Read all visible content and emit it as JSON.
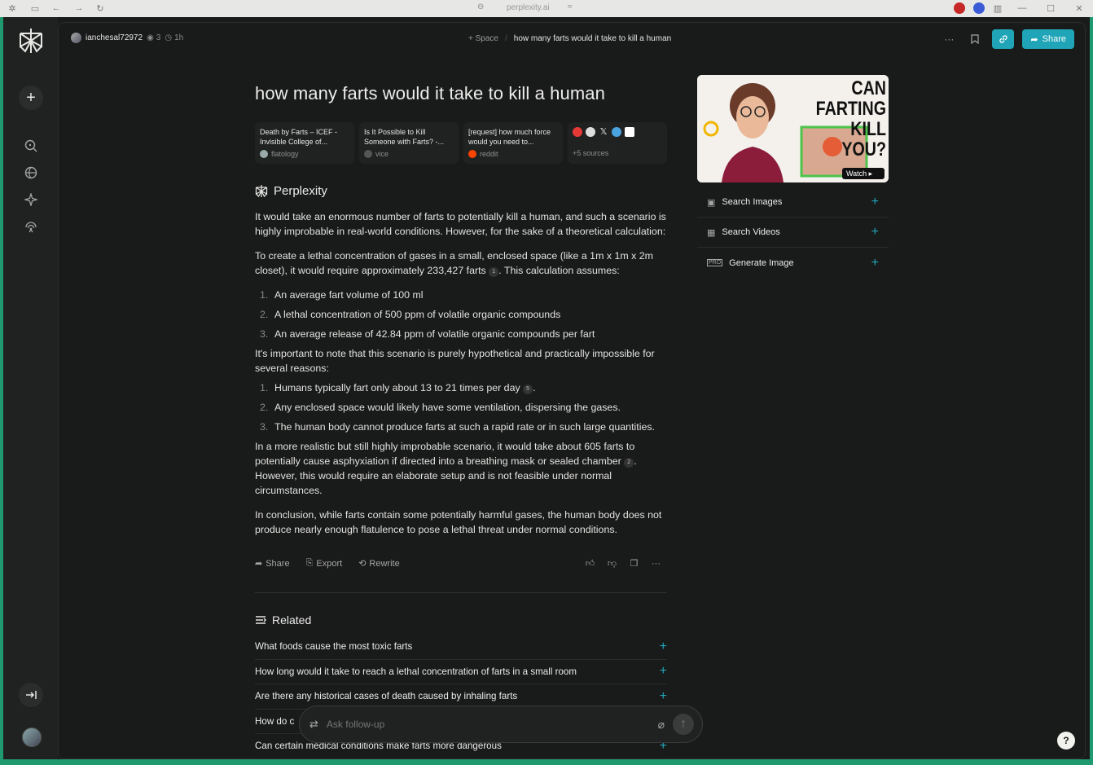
{
  "browser": {
    "url": "perplexity.ai"
  },
  "header": {
    "username": "ianchesal72972",
    "views": "3",
    "age": "1h",
    "space_label": "Space",
    "breadcrumb_title": "how many farts would it take to kill a human",
    "share_label": "Share"
  },
  "thread": {
    "title": "how many farts would it take to kill a human",
    "sources": [
      {
        "title": "Death by Farts – ICEF - Invisible College of...",
        "domain": "flatology"
      },
      {
        "title": "Is It Possible to Kill Someone with Farts? -...",
        "domain": "vice"
      },
      {
        "title": "[request] how much force would you need to...",
        "domain": "reddit"
      }
    ],
    "more_sources": "+5 sources",
    "answer_brand": "Perplexity",
    "p1": "It would take an enormous number of farts to potentially kill a human, and such a scenario is highly improbable in real-world conditions. However, for the sake of a theoretical calculation:",
    "p2_a": "To create a lethal concentration of gases in a small, enclosed space (like a 1m x 1m x 2m closet), it would require approximately 233,427 farts",
    "p2_cite": "1",
    "p2_b": ". This calculation assumes:",
    "list1": [
      {
        "n": "1.",
        "text": "An average fart volume of 100 ml"
      },
      {
        "n": "2.",
        "text": "A lethal concentration of 500 ppm of volatile organic compounds"
      },
      {
        "n": "3.",
        "text": "An average release of 42.84 ppm of volatile organic compounds per fart"
      }
    ],
    "p3": "It's important to note that this scenario is purely hypothetical and practically impossible for several reasons:",
    "list2_1_a": "Humans typically fart only about 13 to 21 times per day",
    "list2_1_cite": "5",
    "list2_1_b": ".",
    "list2": [
      {
        "n": "1."
      },
      {
        "n": "2.",
        "text": "Any enclosed space would likely have some ventilation, dispersing the gases."
      },
      {
        "n": "3.",
        "text": "The human body cannot produce farts at such a rapid rate or in such large quantities."
      }
    ],
    "p4_a": "In a more realistic but still highly improbable scenario, it would take about 605 farts to potentially cause asphyxiation if directed into a breathing mask or sealed chamber",
    "p4_cite": "2",
    "p4_b": ". However, this would require an elaborate setup and is not feasible under normal circumstances.",
    "p5": "In conclusion, while farts contain some potentially harmful gases, the human body does not produce nearly enough flatulence to pose a lethal threat under normal conditions.",
    "actions": {
      "share": "Share",
      "export": "Export",
      "rewrite": "Rewrite"
    },
    "related_label": "Related",
    "related": [
      "What foods cause the most toxic farts",
      "How long would it take to reach a lethal concentration of farts in a small room",
      "Are there any historical cases of death caused by inhaling farts",
      "How do c",
      "Can certain medical conditions make farts more dangerous"
    ]
  },
  "followup": {
    "placeholder": "Ask follow-up"
  },
  "right_panel": {
    "thumb_text_1": "CAN FARTING",
    "thumb_text_2": "KILL YOU?",
    "watch_label": "Watch",
    "items": [
      "Search Images",
      "Search Videos",
      "Generate Image"
    ]
  },
  "colors": {
    "accent": "#1fa5b7",
    "bg": "#191a1a",
    "frame": "#1f9a6f"
  }
}
